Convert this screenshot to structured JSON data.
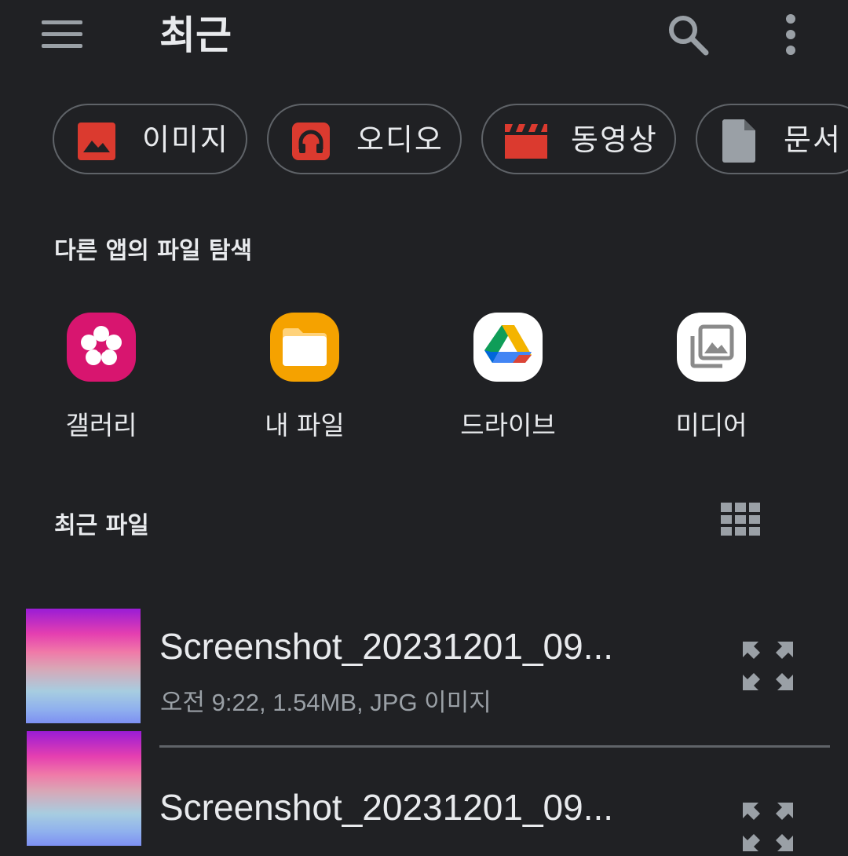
{
  "header": {
    "title": "최근"
  },
  "icons": {
    "menu": "hamburger-menu-icon",
    "search": "search-icon",
    "more": "more-vert-icon",
    "grid": "grid-view-icon",
    "expand": "expand-icon"
  },
  "colors": {
    "background": "#202124",
    "chip_accent": "#db3a2f",
    "document_gray": "#9aa0a6",
    "gallery_pink": "#d8156f",
    "myfiles_orange": "#f5a200"
  },
  "chips": [
    {
      "label": "이미지",
      "icon": "image-icon"
    },
    {
      "label": "오디오",
      "icon": "headphones-icon"
    },
    {
      "label": "동영상",
      "icon": "video-clapper-icon"
    },
    {
      "label": "문서",
      "icon": "document-icon"
    }
  ],
  "apps_section": {
    "title": "다른 앱의 파일 탐색",
    "apps": [
      {
        "label": "갤러리",
        "icon": "gallery-flower-icon"
      },
      {
        "label": "내 파일",
        "icon": "folder-icon"
      },
      {
        "label": "드라이브",
        "icon": "google-drive-icon"
      },
      {
        "label": "미디어",
        "icon": "media-library-icon"
      }
    ]
  },
  "recent_section": {
    "title": "최근 파일",
    "files": [
      {
        "name": "Screenshot_20231201_09...",
        "meta": "오전 9:22, 1.54MB, JPG 이미지"
      },
      {
        "name": "Screenshot_20231201_09...",
        "meta": ""
      }
    ]
  }
}
